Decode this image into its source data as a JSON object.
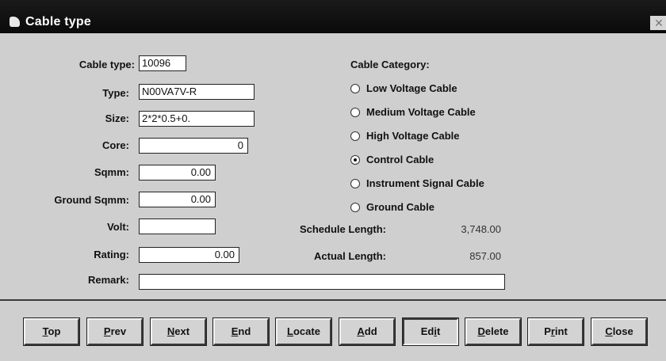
{
  "window": {
    "title": "Cable type",
    "close_glyph": "✕"
  },
  "form": {
    "cable_type": {
      "label": "Cable type:",
      "value": "10096"
    },
    "type": {
      "label": "Type:",
      "value": "N00VA7V-R"
    },
    "size": {
      "label": "Size:",
      "value": "2*2*0.5+0."
    },
    "core": {
      "label": "Core:",
      "value": "0"
    },
    "sqmm": {
      "label": "Sqmm:",
      "value": "0.00"
    },
    "ground_sqmm": {
      "label": "Ground Sqmm:",
      "value": "0.00"
    },
    "volt": {
      "label": "Volt:",
      "value": ""
    },
    "rating": {
      "label": "Rating:",
      "value": "0.00"
    },
    "remark": {
      "label": "Remark:",
      "value": ""
    }
  },
  "category": {
    "title": "Cable Category:",
    "options": [
      {
        "label": "Low Voltage Cable",
        "selected": false
      },
      {
        "label": "Medium Voltage Cable",
        "selected": false
      },
      {
        "label": "High Voltage Cable",
        "selected": false
      },
      {
        "label": "Control Cable",
        "selected": true
      },
      {
        "label": "Instrument Signal Cable",
        "selected": false
      },
      {
        "label": "Ground Cable",
        "selected": false
      }
    ]
  },
  "lengths": {
    "schedule": {
      "label": "Schedule Length:",
      "value": "3,748.00"
    },
    "actual": {
      "label": "Actual Length:",
      "value": "857.00"
    }
  },
  "buttons": {
    "top": {
      "key": "T",
      "rest": "op"
    },
    "prev": {
      "key": "P",
      "rest": "rev"
    },
    "next": {
      "key": "N",
      "rest": "ext"
    },
    "end": {
      "key": "E",
      "rest": "nd"
    },
    "locate": {
      "key": "L",
      "rest": "ocate"
    },
    "add": {
      "key": "A",
      "rest": "dd"
    },
    "edit": {
      "pre": "Ed",
      "key": "i",
      "rest": "t"
    },
    "delete": {
      "key": "D",
      "rest": "elete"
    },
    "print": {
      "pre": "P",
      "key": "r",
      "rest": "int"
    },
    "close": {
      "key": "C",
      "rest": "lose"
    }
  },
  "colors": {
    "titlebar": "#0a0a0a",
    "window_bg": "#cfcfcf",
    "field_bg": "#ffffff"
  }
}
